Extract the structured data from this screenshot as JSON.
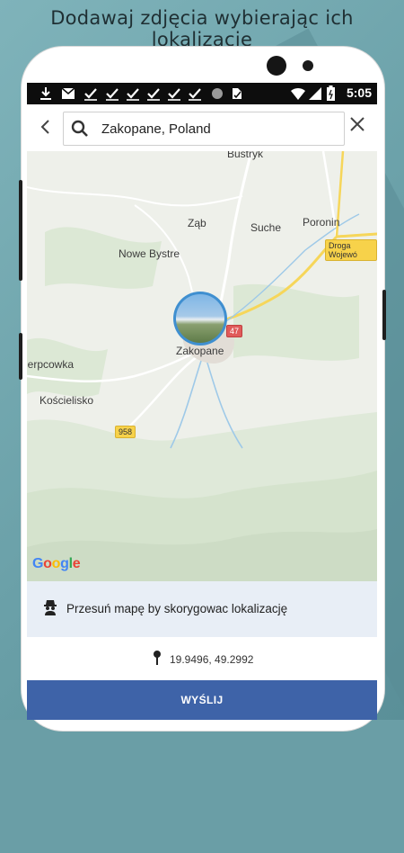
{
  "headline": "Dodawaj zdjęcia wybierając ich lokalizację",
  "status_bar": {
    "time": "5:05",
    "notification_icons": [
      "download-icon",
      "mail-icon",
      "check-icon",
      "check-icon",
      "check-icon",
      "check-icon",
      "check-icon",
      "check-icon",
      "record-icon",
      "task-icon"
    ],
    "system_icons": [
      "wifi-icon",
      "signal-icon",
      "battery-icon"
    ]
  },
  "search": {
    "value": "Zakopane, Poland",
    "back_icon": "back-arrow-icon",
    "search_icon": "search-icon",
    "close_icon": "close-icon"
  },
  "map": {
    "labels": {
      "bustryk": "Bustryk",
      "zab": "Ząb",
      "suche": "Suche",
      "poronin": "Poronin",
      "nowe_bystre": "Nowe Bystre",
      "zakopane": "Zakopane",
      "ierpcowka": "ierpcowka",
      "koscielisko": "Kościelisko",
      "droga": "Droga Wojewó",
      "road_958": "958",
      "road_47": "47"
    },
    "attribution": "Google",
    "colors": {
      "terrain": "#eef0ea",
      "forest": "#cfe1c6",
      "road_main": "#f6d65a",
      "river": "#9ec9e8"
    }
  },
  "info": {
    "text": "Przesuń mapę by skorygowac lokalizację",
    "icon": "spy-icon"
  },
  "location": {
    "coords": "19.9496, 49.2992",
    "icon": "pin-icon"
  },
  "action": {
    "send_label": "WYŚLIJ",
    "color": "#3e63a8"
  }
}
